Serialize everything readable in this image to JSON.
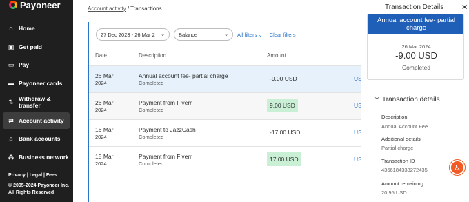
{
  "sidebar": {
    "logo_text": "Payoneer",
    "items": [
      {
        "label": "Home",
        "icon": "home-icon"
      },
      {
        "label": "Get paid",
        "icon": "get-paid-icon"
      },
      {
        "label": "Pay",
        "icon": "pay-icon"
      },
      {
        "label": "Payoneer cards",
        "icon": "card-icon"
      },
      {
        "label": "Withdraw & transfer",
        "icon": "withdraw-icon"
      },
      {
        "label": "Account activity",
        "icon": "activity-icon",
        "active": true
      },
      {
        "label": "Bank accounts",
        "icon": "bank-icon"
      },
      {
        "label": "Business network",
        "icon": "network-icon"
      }
    ],
    "legal": "Privacy | Legal | Fees",
    "copyright": "© 2005-2024 Payoneer Inc. All Rights Reserved"
  },
  "breadcrumb": {
    "parent": "Account activity",
    "separator": "/",
    "current": "Transactions"
  },
  "filters": {
    "date_range": "27 Dec 2023 - 26 Mar 2",
    "balance": "Balance",
    "all_filters": "All filters",
    "clear_filters": "Clear filters"
  },
  "table": {
    "headers": {
      "date": "Date",
      "description": "Description",
      "amount": "Amount"
    },
    "rows": [
      {
        "date": "26 Mar",
        "year": "2024",
        "description": "Annual account fee- partial charge",
        "status": "Completed",
        "amount": "-9.00 USD",
        "positive": false,
        "currency": "US"
      },
      {
        "date": "26 Mar",
        "year": "2024",
        "description": "Payment from Fiverr",
        "status": "Completed",
        "amount": "9.00 USD",
        "positive": true,
        "currency": "US"
      },
      {
        "date": "16 Mar",
        "year": "2024",
        "description": "Payment to JazzCash",
        "status": "Completed",
        "amount": "-17.00 USD",
        "positive": false,
        "currency": "US"
      },
      {
        "date": "15 Mar",
        "year": "2024",
        "description": "Payment from Fiverr",
        "status": "Completed",
        "amount": "17.00 USD",
        "positive": true,
        "currency": "US"
      }
    ]
  },
  "panel": {
    "title": "Transaction Details",
    "summary": {
      "heading": "Annual account fee- partial charge",
      "date": "26 Mar 2024",
      "amount": "-9.00 USD",
      "status": "Completed"
    },
    "section_title": "Transaction details",
    "details": [
      {
        "label": "Description",
        "value": "Annual Account Fee"
      },
      {
        "label": "Additional details",
        "value": "Partial charge"
      },
      {
        "label": "Transaction ID",
        "value": "4366184338272435"
      },
      {
        "label": "Amount remaining",
        "value": "20.95 USD"
      }
    ]
  },
  "colors": {
    "accent": "#2a74c9",
    "sidebar_bg": "#1f1f1f",
    "positive_bg": "#c9efd5",
    "selected_row": "#e6f1fb",
    "panel_head": "#1f5fb8",
    "a11y": "#f15a24"
  }
}
